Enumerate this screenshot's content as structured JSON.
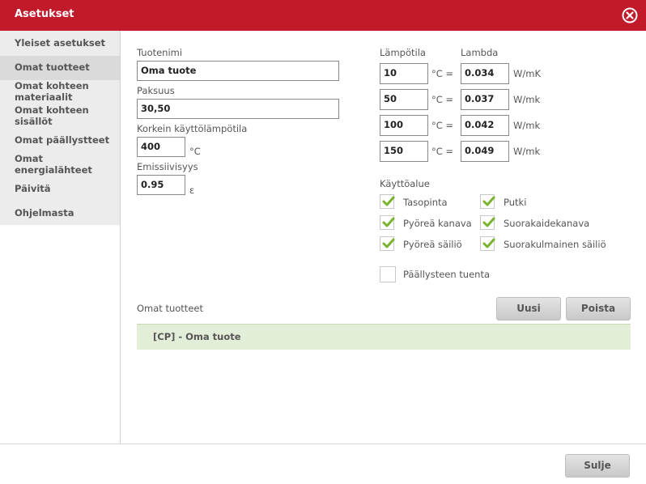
{
  "window": {
    "title": "Asetukset"
  },
  "sidebar": {
    "items": [
      {
        "label": "Yleiset asetukset"
      },
      {
        "label": "Omat tuotteet"
      },
      {
        "label": "Omat kohteen materiaalit"
      },
      {
        "label": "Omat kohteen sisällöt"
      },
      {
        "label": "Omat päällystteet"
      },
      {
        "label": "Omat energialähteet"
      },
      {
        "label": "Päivitä"
      },
      {
        "label": "Ohjelmasta"
      }
    ]
  },
  "product": {
    "name_label": "Tuotenimi",
    "name_value": "Oma tuote",
    "thickness_label": "Paksuus",
    "thickness_value": "30,50",
    "max_temp_label": "Korkein käyttölämpötila",
    "max_temp_value": "400",
    "max_temp_unit": "°C",
    "emissivity_label": "Emissiivisyys",
    "emissivity_value": "0.95",
    "emissivity_unit": "ε"
  },
  "lambda_table": {
    "temp_header": "Lämpötila",
    "lambda_header": "Lambda",
    "rows": [
      {
        "temp": "10",
        "temp_unit": "°C =",
        "lambda": "0.034",
        "lambda_unit": "W/mK"
      },
      {
        "temp": "50",
        "temp_unit": "°C =",
        "lambda": "0.037",
        "lambda_unit": "W/mk"
      },
      {
        "temp": "100",
        "temp_unit": "°C =",
        "lambda": "0.042",
        "lambda_unit": "W/mk"
      },
      {
        "temp": "150",
        "temp_unit": "°C =",
        "lambda": "0.049",
        "lambda_unit": "W/mk"
      }
    ]
  },
  "usage": {
    "title": "Käyttöalue",
    "options": [
      {
        "label": "Tasopinta",
        "checked": true
      },
      {
        "label": "Putki",
        "checked": true
      },
      {
        "label": "Pyöreä kanava",
        "checked": true
      },
      {
        "label": "Suorakaidekanava",
        "checked": true
      },
      {
        "label": "Pyöreä säiliö",
        "checked": true
      },
      {
        "label": "Suorakulmainen säiliö",
        "checked": true
      }
    ],
    "coating_support": {
      "label": "Päällysteen tuenta",
      "checked": false
    }
  },
  "own_products": {
    "title": "Omat tuotteet",
    "new_label": "Uusi",
    "delete_label": "Poista",
    "items": [
      {
        "label": "[CP] - Oma tuote"
      }
    ]
  },
  "footer": {
    "close_label": "Sulje"
  },
  "colors": {
    "titlebar": "#c01a2b",
    "check": "#7ab32e",
    "list_bg": "#e3eed8"
  }
}
